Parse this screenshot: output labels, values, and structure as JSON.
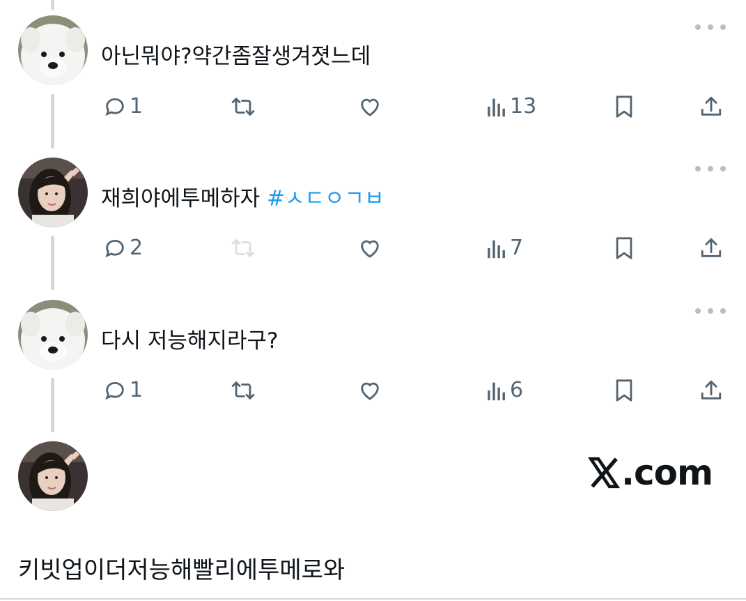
{
  "tweets": [
    {
      "author": "dog",
      "text": "아닌뭐야?약간좀잘생겨졋느데",
      "replies": "1",
      "retweet_dimmed": false,
      "views": "13"
    },
    {
      "author": "girl",
      "text": "재희야에투메하자 ",
      "hashtag": "#ㅅㄷㅇㄱㅂ",
      "replies": "2",
      "retweet_dimmed": true,
      "views": "7"
    },
    {
      "author": "dog",
      "text": "다시 저능해지라구?",
      "replies": "1",
      "retweet_dimmed": false,
      "views": "6"
    }
  ],
  "final_post": {
    "author": "girl",
    "text": "키빗업이더저능해빨리에투메로와"
  },
  "watermark": ".com",
  "colors": {
    "text": "#0f1419",
    "icon": "#536471",
    "hashtag": "#1d9bf0",
    "thread_line": "#cfd9de"
  },
  "icons": [
    "reply-icon",
    "retweet-icon",
    "like-icon",
    "views-icon",
    "bookmark-icon",
    "share-icon",
    "more-icon"
  ]
}
